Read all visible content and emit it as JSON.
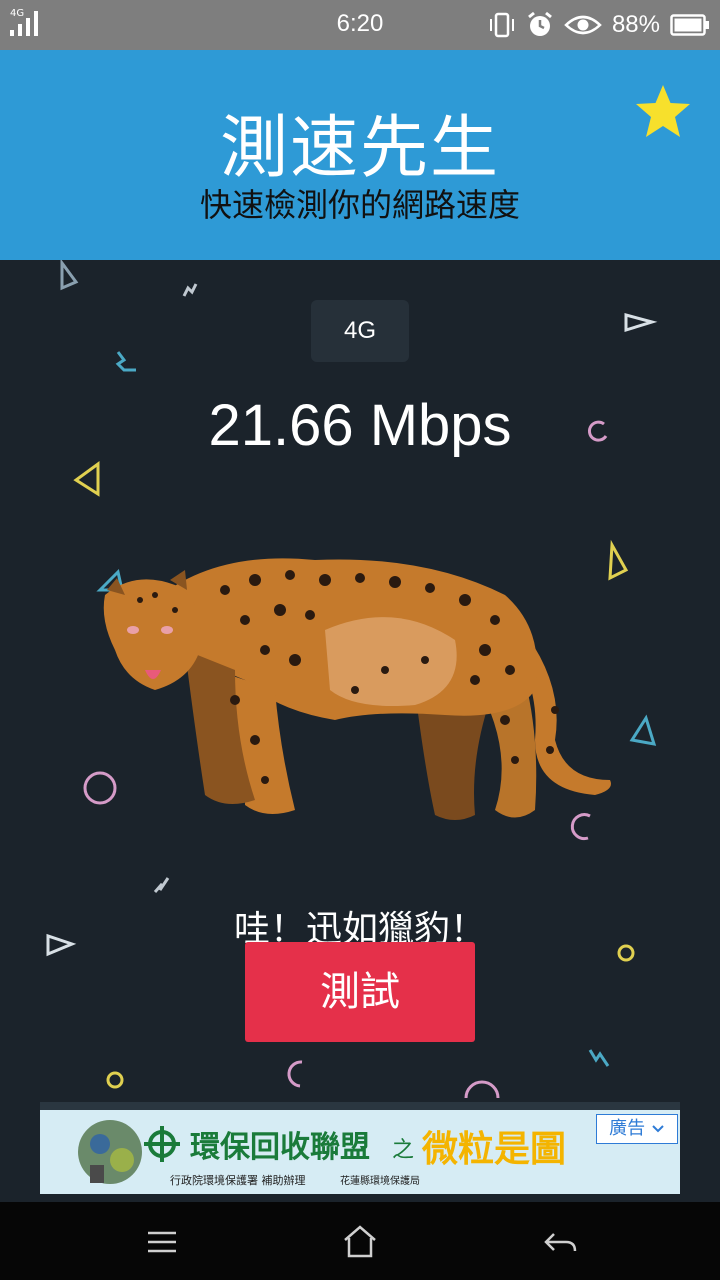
{
  "status_bar": {
    "network_label": "4G",
    "time": "6:20",
    "battery_percent": "88%",
    "icons": [
      "signal-icon",
      "vibrate-icon",
      "alarm-icon",
      "eye-icon",
      "battery-icon"
    ]
  },
  "header": {
    "title": "測速先生",
    "subtitle": "快速檢測你的網路速度",
    "background": "#2e9ad6",
    "favorite_icon": "star-icon"
  },
  "main": {
    "network_type": "4G",
    "speed": "21.66 Mbps",
    "message": "哇！迅如獵豹！",
    "test_button_label": "測試",
    "button_color": "#e5304a",
    "illustration": "leopard-illustration"
  },
  "ad": {
    "title": "環保回收聯盟",
    "connector": "之",
    "title_highlight": "微粒是圖",
    "sponsor_1": "行政院環境保護署 補助辦理",
    "sponsor_2": "花蓮縣環境保護局",
    "label": "廣告"
  },
  "nav": {
    "icons": [
      "menu-icon",
      "home-icon",
      "back-icon"
    ]
  }
}
